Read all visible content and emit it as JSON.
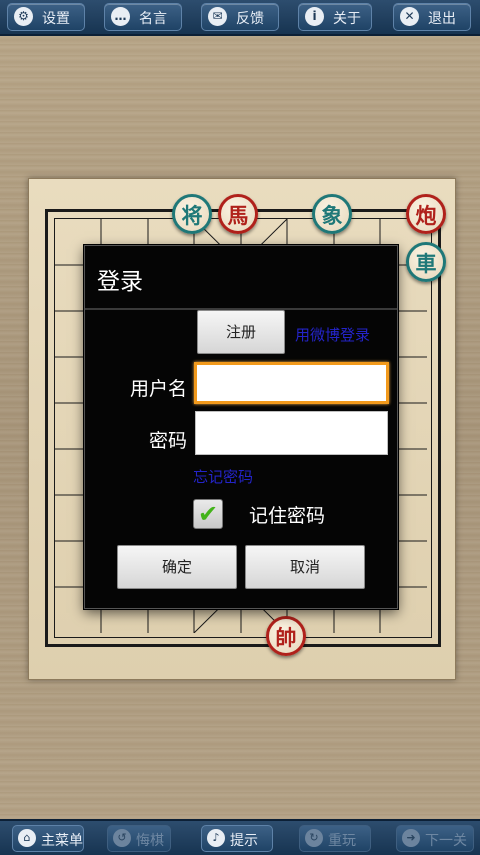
{
  "toolbar": {
    "settings": "设置",
    "quotes": "名言",
    "feedback": "反馈",
    "about": "关于",
    "exit": "退出"
  },
  "bottom_bar": {
    "main_menu": "主菜单",
    "undo": "悔棋",
    "hint": "提示",
    "restart": "重玩",
    "next": "下一关"
  },
  "pieces": {
    "green_general": "将",
    "red_horse": "馬",
    "green_elephant": "象",
    "red_cannon": "炮",
    "green_chariot": "車",
    "red_marshal": "帥"
  },
  "dialog": {
    "title": "登录",
    "register_button": "注册",
    "weibo_login_link": "用微博登录",
    "username_label": "用户名",
    "username_value": "",
    "password_label": "密码",
    "password_value": "",
    "forgot_password_link": "忘记密码",
    "remember_label": "记住密码",
    "remember_checked": true,
    "confirm_button": "确定",
    "cancel_button": "取消"
  },
  "colors": {
    "toolbar": "#1f4366",
    "red_piece": "#b0211b",
    "green_piece": "#1f7878",
    "focus_border": "#f29a1c",
    "link": "#2424c8"
  }
}
